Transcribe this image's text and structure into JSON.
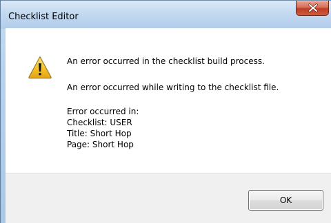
{
  "window": {
    "title": "Checklist Editor"
  },
  "message": {
    "main_instruction": "An error occurred in the checklist build process.",
    "detail": "An error occurred while writing to the checklist file.",
    "info_lines": [
      "Error occurred in:",
      "Checklist: USER",
      "Title: Short Hop",
      "Page: Short Hop"
    ]
  },
  "buttons": {
    "ok_label": "OK"
  },
  "icons": {
    "status": "warning-icon",
    "close": "close-icon"
  },
  "colors": {
    "close_button": "#c9452b",
    "warning_fill": "#f7c531",
    "footer_bg": "#f0f0f0",
    "frame_tint": "#b6d1ec"
  }
}
